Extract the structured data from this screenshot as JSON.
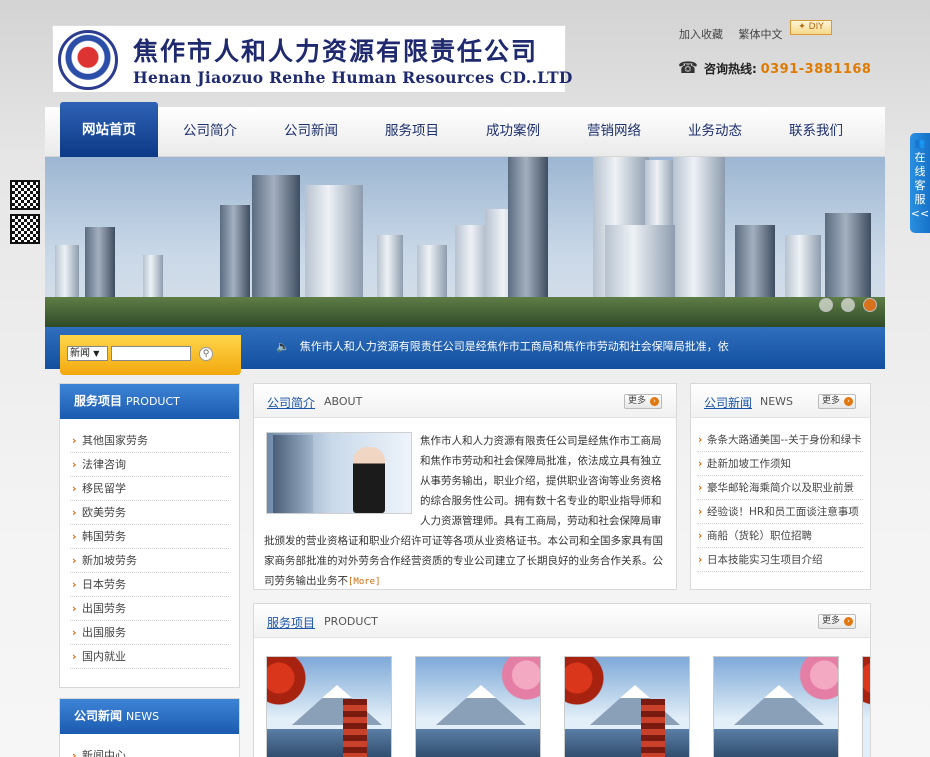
{
  "header": {
    "company_cn": "焦作市人和人力资源有限责任公司",
    "company_en": "Henan Jiaozuo Renhe Human Resources CD..LTD",
    "links": [
      "加入收藏",
      "繁体中文"
    ],
    "diy_label": "DIY",
    "hotline_label": "咨询热线:",
    "hotline_number": "0391-3881168"
  },
  "nav": {
    "items": [
      "网站首页",
      "公司简介",
      "公司新闻",
      "服务项目",
      "成功案例",
      "营销网络",
      "业务动态",
      "联系我们"
    ],
    "active_index": 0
  },
  "banner": {
    "slide_count": 3,
    "active_slide": 3
  },
  "search": {
    "select_value": "新闻",
    "input_value": ""
  },
  "ticker": {
    "text": "焦作市人和人力资源有限责任公司是经焦作市工商局和焦作市劳动和社会保障局批准，依"
  },
  "sidebar_services": {
    "title": "服务项目",
    "title_en": "PRODUCT",
    "items": [
      "其他国家劳务",
      "法律咨询",
      "移民留学",
      "欧美劳务",
      "韩国劳务",
      "新加坡劳务",
      "日本劳务",
      "出国劳务",
      "出国服务",
      "国内就业"
    ]
  },
  "sidebar_news": {
    "title": "公司新闻",
    "title_en": "NEWS",
    "items": [
      "新闻中心"
    ]
  },
  "about": {
    "title": "公司简介",
    "title_en": "ABOUT",
    "more_label": "更多",
    "text": "焦作市人和人力资源有限责任公司是经焦作市工商局和焦作市劳动和社会保障局批准，依法成立具有独立从事劳务输出，职业介绍，提供职业咨询等业务资格的综合服务性公司。拥有数十名专业的职业指导师和人力资源管理师。具有工商局，劳动和社会保障局审批颁发的营业资格证和职业介绍许可证等各项从业资格证书。本公司和全国多家具有国家商务部批准的对外劳务合作经营资质的专业公司建立了长期良好的业务合作关系。公司劳务输出业务不",
    "more_inline": "[More]"
  },
  "news": {
    "title": "公司新闻",
    "title_en": "NEWS",
    "more_label": "更多",
    "items": [
      "条条大路通美国--关于身份和绿卡",
      "赴新加坡工作须知",
      "豪华邮轮海乘简介以及职业前景",
      "经验谈！HR和员工面谈注意事项",
      "商船（货轮）职位招聘",
      "日本技能实习生项目介绍"
    ]
  },
  "products": {
    "title": "服务项目",
    "title_en": "PRODUCT",
    "more_label": "更多",
    "count": 4
  },
  "customer_service": {
    "label": "在线客服",
    "toggle": "<<"
  },
  "colors": {
    "nav_active": "#0c3986",
    "brand_blue": "#1b5bb0",
    "accent_orange": "#e07b00",
    "link_blue": "#1c55a8"
  }
}
